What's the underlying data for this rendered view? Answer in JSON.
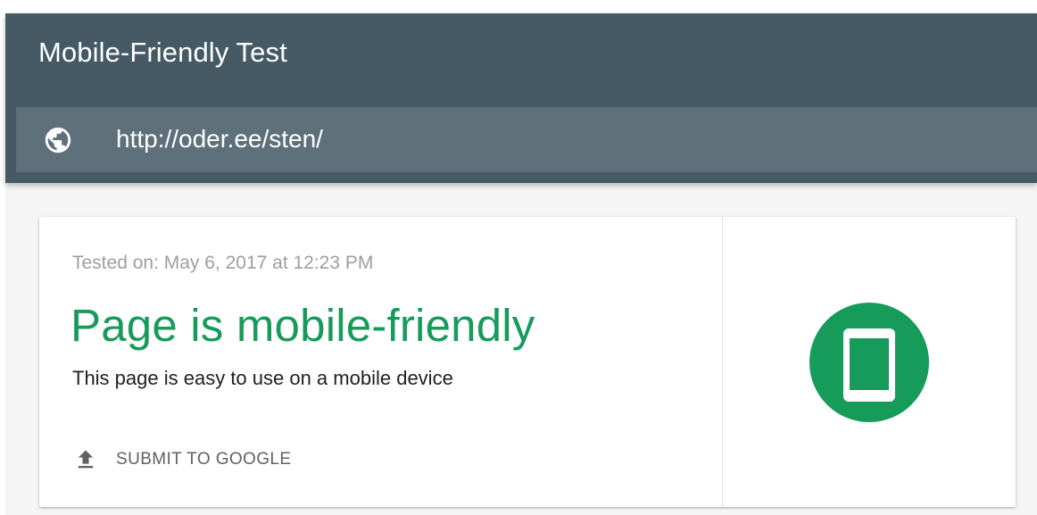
{
  "header": {
    "title": "Mobile-Friendly Test",
    "url_value": "http://oder.ee/sten/",
    "url_icon": "globe-icon"
  },
  "result": {
    "tested_on": "Tested on: May 6, 2017 at 12:23 PM",
    "status_title": "Page is mobile-friendly",
    "description": "This page is easy to use on a mobile device",
    "submit_label": "SUBMIT TO GOOGLE",
    "submit_icon": "upload-icon",
    "badge_icon": "mobile-phone-icon"
  },
  "colors": {
    "header_bg": "#455a64",
    "url_bar_bg": "#5e707a",
    "success_green": "#169b5b",
    "content_bg": "#f5f5f5"
  }
}
